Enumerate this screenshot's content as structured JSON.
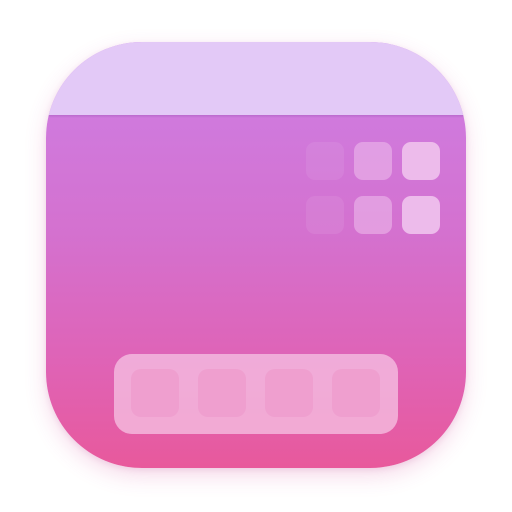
{
  "icon": {
    "kind": "app-icon",
    "depicts": "window-with-grid-and-dock",
    "colors": {
      "gradient_top": "#cd7fe6",
      "gradient_bottom": "#e8599c",
      "title_band": "#e3c9f7",
      "grid_tile": "#eebfec",
      "dock_tray": "#f7c8e6",
      "dock_slot": "#ef9fcf"
    }
  },
  "grid": {
    "rows": 2,
    "columns": 3,
    "column_opacity": [
      0.15,
      0.55,
      0.95
    ]
  },
  "dock": {
    "slot_count": 4
  }
}
